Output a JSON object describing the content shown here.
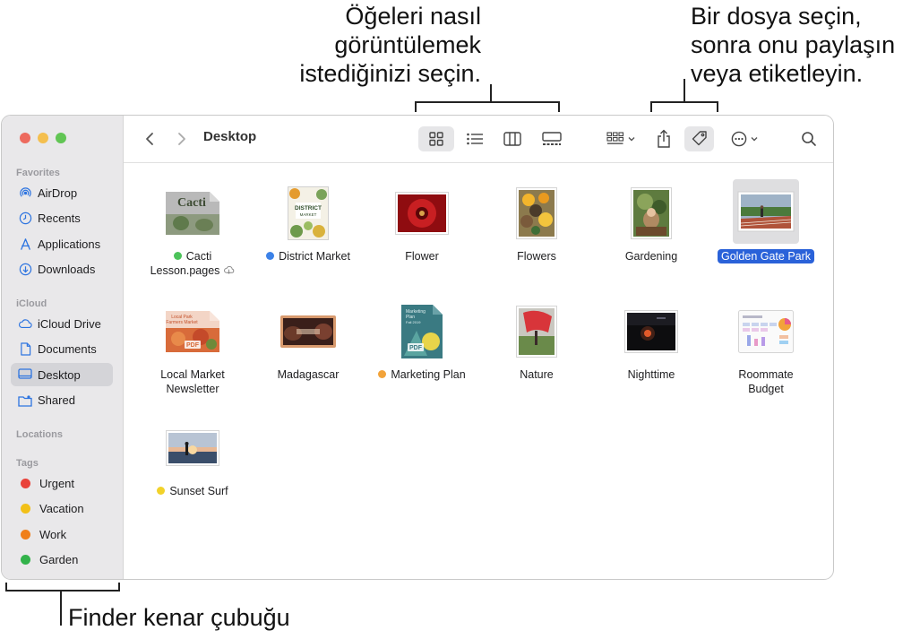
{
  "callouts": {
    "view": [
      "Öğeleri nasıl",
      "görüntülemek",
      "istediğinizi seçin."
    ],
    "file": [
      "Bir dosya seçin,",
      "sonra onu paylaşın",
      "veya etiketleyin."
    ],
    "sidebar": "Finder kenar çubuğu"
  },
  "sidebar": {
    "favorites_header": "Favorites",
    "favorites": [
      {
        "label": "AirDrop",
        "icon": "airdrop-icon"
      },
      {
        "label": "Recents",
        "icon": "clock-icon"
      },
      {
        "label": "Applications",
        "icon": "applications-icon"
      },
      {
        "label": "Downloads",
        "icon": "download-icon"
      }
    ],
    "icloud_header": "iCloud",
    "icloud": [
      {
        "label": "iCloud Drive",
        "icon": "cloud-icon"
      },
      {
        "label": "Documents",
        "icon": "document-icon"
      },
      {
        "label": "Desktop",
        "icon": "desktop-icon",
        "selected": true
      },
      {
        "label": "Shared",
        "icon": "shared-folder-icon"
      }
    ],
    "locations_header": "Locations",
    "tags_header": "Tags",
    "tags": [
      {
        "label": "Urgent",
        "color": "#e9423a"
      },
      {
        "label": "Vacation",
        "color": "#f2c018"
      },
      {
        "label": "Work",
        "color": "#f07f1a"
      },
      {
        "label": "Garden",
        "color": "#32b24a"
      }
    ]
  },
  "toolbar": {
    "title": "Desktop",
    "active_view": "icons"
  },
  "files": [
    {
      "name": "Cacti Lesson.pages",
      "lines": [
        "Cacti",
        "Lesson.pages"
      ],
      "tag": "#4cc35a",
      "kind": "pages",
      "icloud": true
    },
    {
      "name": "District Market",
      "lines": [
        "District Market"
      ],
      "tag": "#3c82e8",
      "kind": "district"
    },
    {
      "name": "Flower",
      "lines": [
        "Flower"
      ],
      "kind": "flower"
    },
    {
      "name": "Flowers",
      "lines": [
        "Flowers"
      ],
      "kind": "flowers"
    },
    {
      "name": "Gardening",
      "lines": [
        "Gardening"
      ],
      "kind": "gardening"
    },
    {
      "name": "Golden Gate Park",
      "lines": [
        "Golden Gate Park"
      ],
      "kind": "park",
      "selected": true
    },
    {
      "name": "Local Market Newsletter",
      "lines": [
        "Local Market",
        "Newsletter"
      ],
      "kind": "newsletter"
    },
    {
      "name": "Madagascar",
      "lines": [
        "Madagascar"
      ],
      "kind": "madagascar"
    },
    {
      "name": "Marketing Plan",
      "lines": [
        "Marketing Plan"
      ],
      "tag": "#f2a33a",
      "kind": "marketing"
    },
    {
      "name": "Nature",
      "lines": [
        "Nature"
      ],
      "kind": "nature"
    },
    {
      "name": "Nighttime",
      "lines": [
        "Nighttime"
      ],
      "kind": "night"
    },
    {
      "name": "Roommate Budget",
      "lines": [
        "Roommate",
        "Budget"
      ],
      "kind": "budget"
    },
    {
      "name": "Sunset Surf",
      "lines": [
        "Sunset Surf"
      ],
      "tag": "#f2d22a",
      "kind": "surf"
    }
  ],
  "thumb_text": {
    "cacti": "Cacti",
    "district": [
      "DISTRICT",
      "MARKET"
    ],
    "newsletter": [
      "Local Park",
      "Farmers Market"
    ],
    "marketing": [
      "Marketing",
      "Plan",
      "Fall 2019"
    ],
    "pdf": "PDF"
  },
  "colors": {
    "accent": "#2a62d9",
    "selection_bg": "#e6e6e8"
  }
}
